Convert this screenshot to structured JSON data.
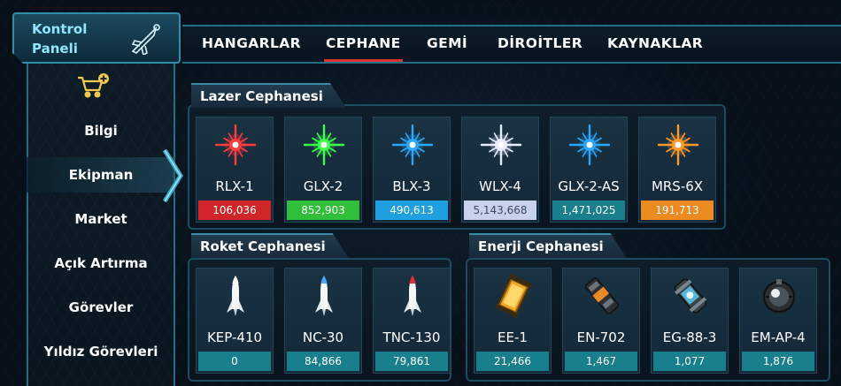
{
  "panel": {
    "title": "Kontrol Paneli",
    "icon": "spaceship-icon"
  },
  "nav": {
    "tabs": [
      {
        "label": "HANGARLAR",
        "active": false
      },
      {
        "label": "CEPHANE",
        "active": true
      },
      {
        "label": "GEMİ",
        "active": false
      },
      {
        "label": "DİROİTLER",
        "active": false
      },
      {
        "label": "KAYNAKLAR",
        "active": false
      }
    ],
    "active_color": "#e0322f"
  },
  "sidebar": {
    "icon": "shopping-cart-add-icon",
    "items": [
      {
        "label": "Bilgi",
        "active": false
      },
      {
        "label": "Ekipman",
        "active": true
      },
      {
        "label": "Market",
        "active": false
      },
      {
        "label": "Açık Artırma",
        "active": false
      },
      {
        "label": "Görevler",
        "active": false
      },
      {
        "label": "Yıldız Görevleri",
        "active": false
      }
    ]
  },
  "laser": {
    "title": "Lazer Cephanesi",
    "items": [
      {
        "name": "RLX-1",
        "count": "106,036",
        "color": "#d0262a",
        "glow": "#ff3a3a"
      },
      {
        "name": "GLX-2",
        "count": "852,903",
        "color": "#2fbf3a",
        "glow": "#3cff4a"
      },
      {
        "name": "BLX-3",
        "count": "490,613",
        "color": "#1f9fe0",
        "glow": "#2aa8ff"
      },
      {
        "name": "WLX-4",
        "count": "5,143,668",
        "color": "#c9d2ea",
        "glow": "#e8eeff"
      },
      {
        "name": "GLX-2-AS",
        "count": "1,471,025",
        "color": "#1a7f8c",
        "glow": "#2aa8ff"
      },
      {
        "name": "MRS-6X",
        "count": "191,713",
        "color": "#ec8a22",
        "glow": "#ff9a2a"
      }
    ]
  },
  "rocket": {
    "title": "Roket Cephanesi",
    "items": [
      {
        "name": "KEP-410",
        "count": "0",
        "tip": "#ffffff"
      },
      {
        "name": "NC-30",
        "count": "84,866",
        "tip": "#4aa8ff"
      },
      {
        "name": "TNC-130",
        "count": "79,861",
        "tip": "#e0322f"
      }
    ]
  },
  "energy": {
    "title": "Enerji Cephanesi",
    "items": [
      {
        "name": "EE-1",
        "count": "21,466",
        "icon": "energy-cell-icon"
      },
      {
        "name": "EN-702",
        "count": "1,467",
        "icon": "energy-canister-icon"
      },
      {
        "name": "EG-88-3",
        "count": "1,077",
        "icon": "energy-generator-icon"
      },
      {
        "name": "EM-AP-4",
        "count": "1,876",
        "icon": "energy-mine-icon"
      }
    ]
  },
  "count_bar_color": "#1a7f8c"
}
